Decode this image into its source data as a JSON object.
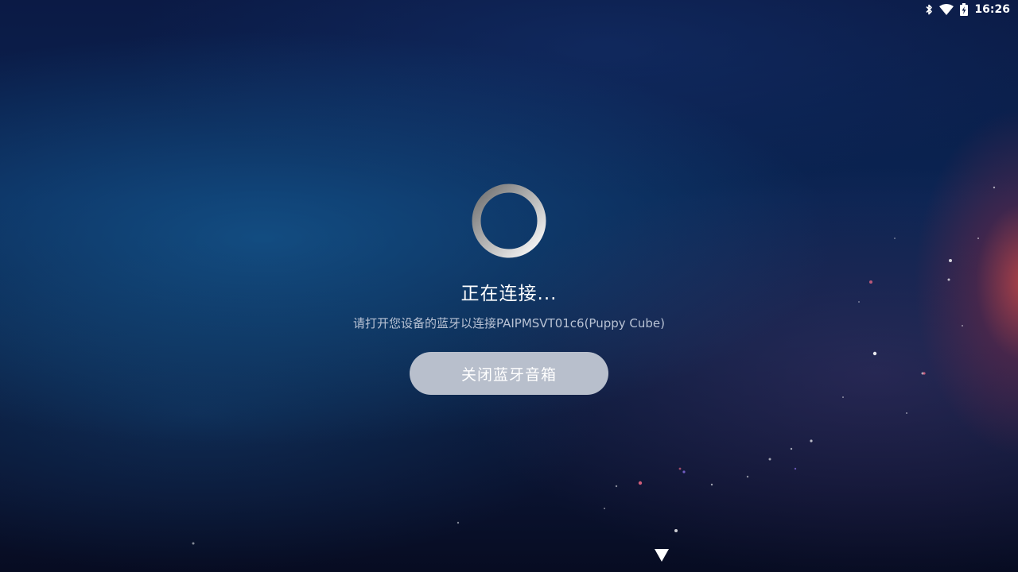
{
  "status_bar": {
    "time": "16:26",
    "icons": [
      "bluetooth-icon",
      "wifi-icon",
      "battery-charging-icon"
    ]
  },
  "connection": {
    "title": "正在连接...",
    "message": "请打开您设备的蓝牙以连接PAIPMSVT01c6(Puppy Cube)"
  },
  "actions": {
    "close_button_label": "关闭蓝牙音箱"
  },
  "navigation": {
    "down_arrow_icon": "down-arrow-icon"
  },
  "colors": {
    "button_background": "#b8bfcc",
    "text_primary": "#ffffff",
    "text_secondary": "#b8c2d4"
  }
}
